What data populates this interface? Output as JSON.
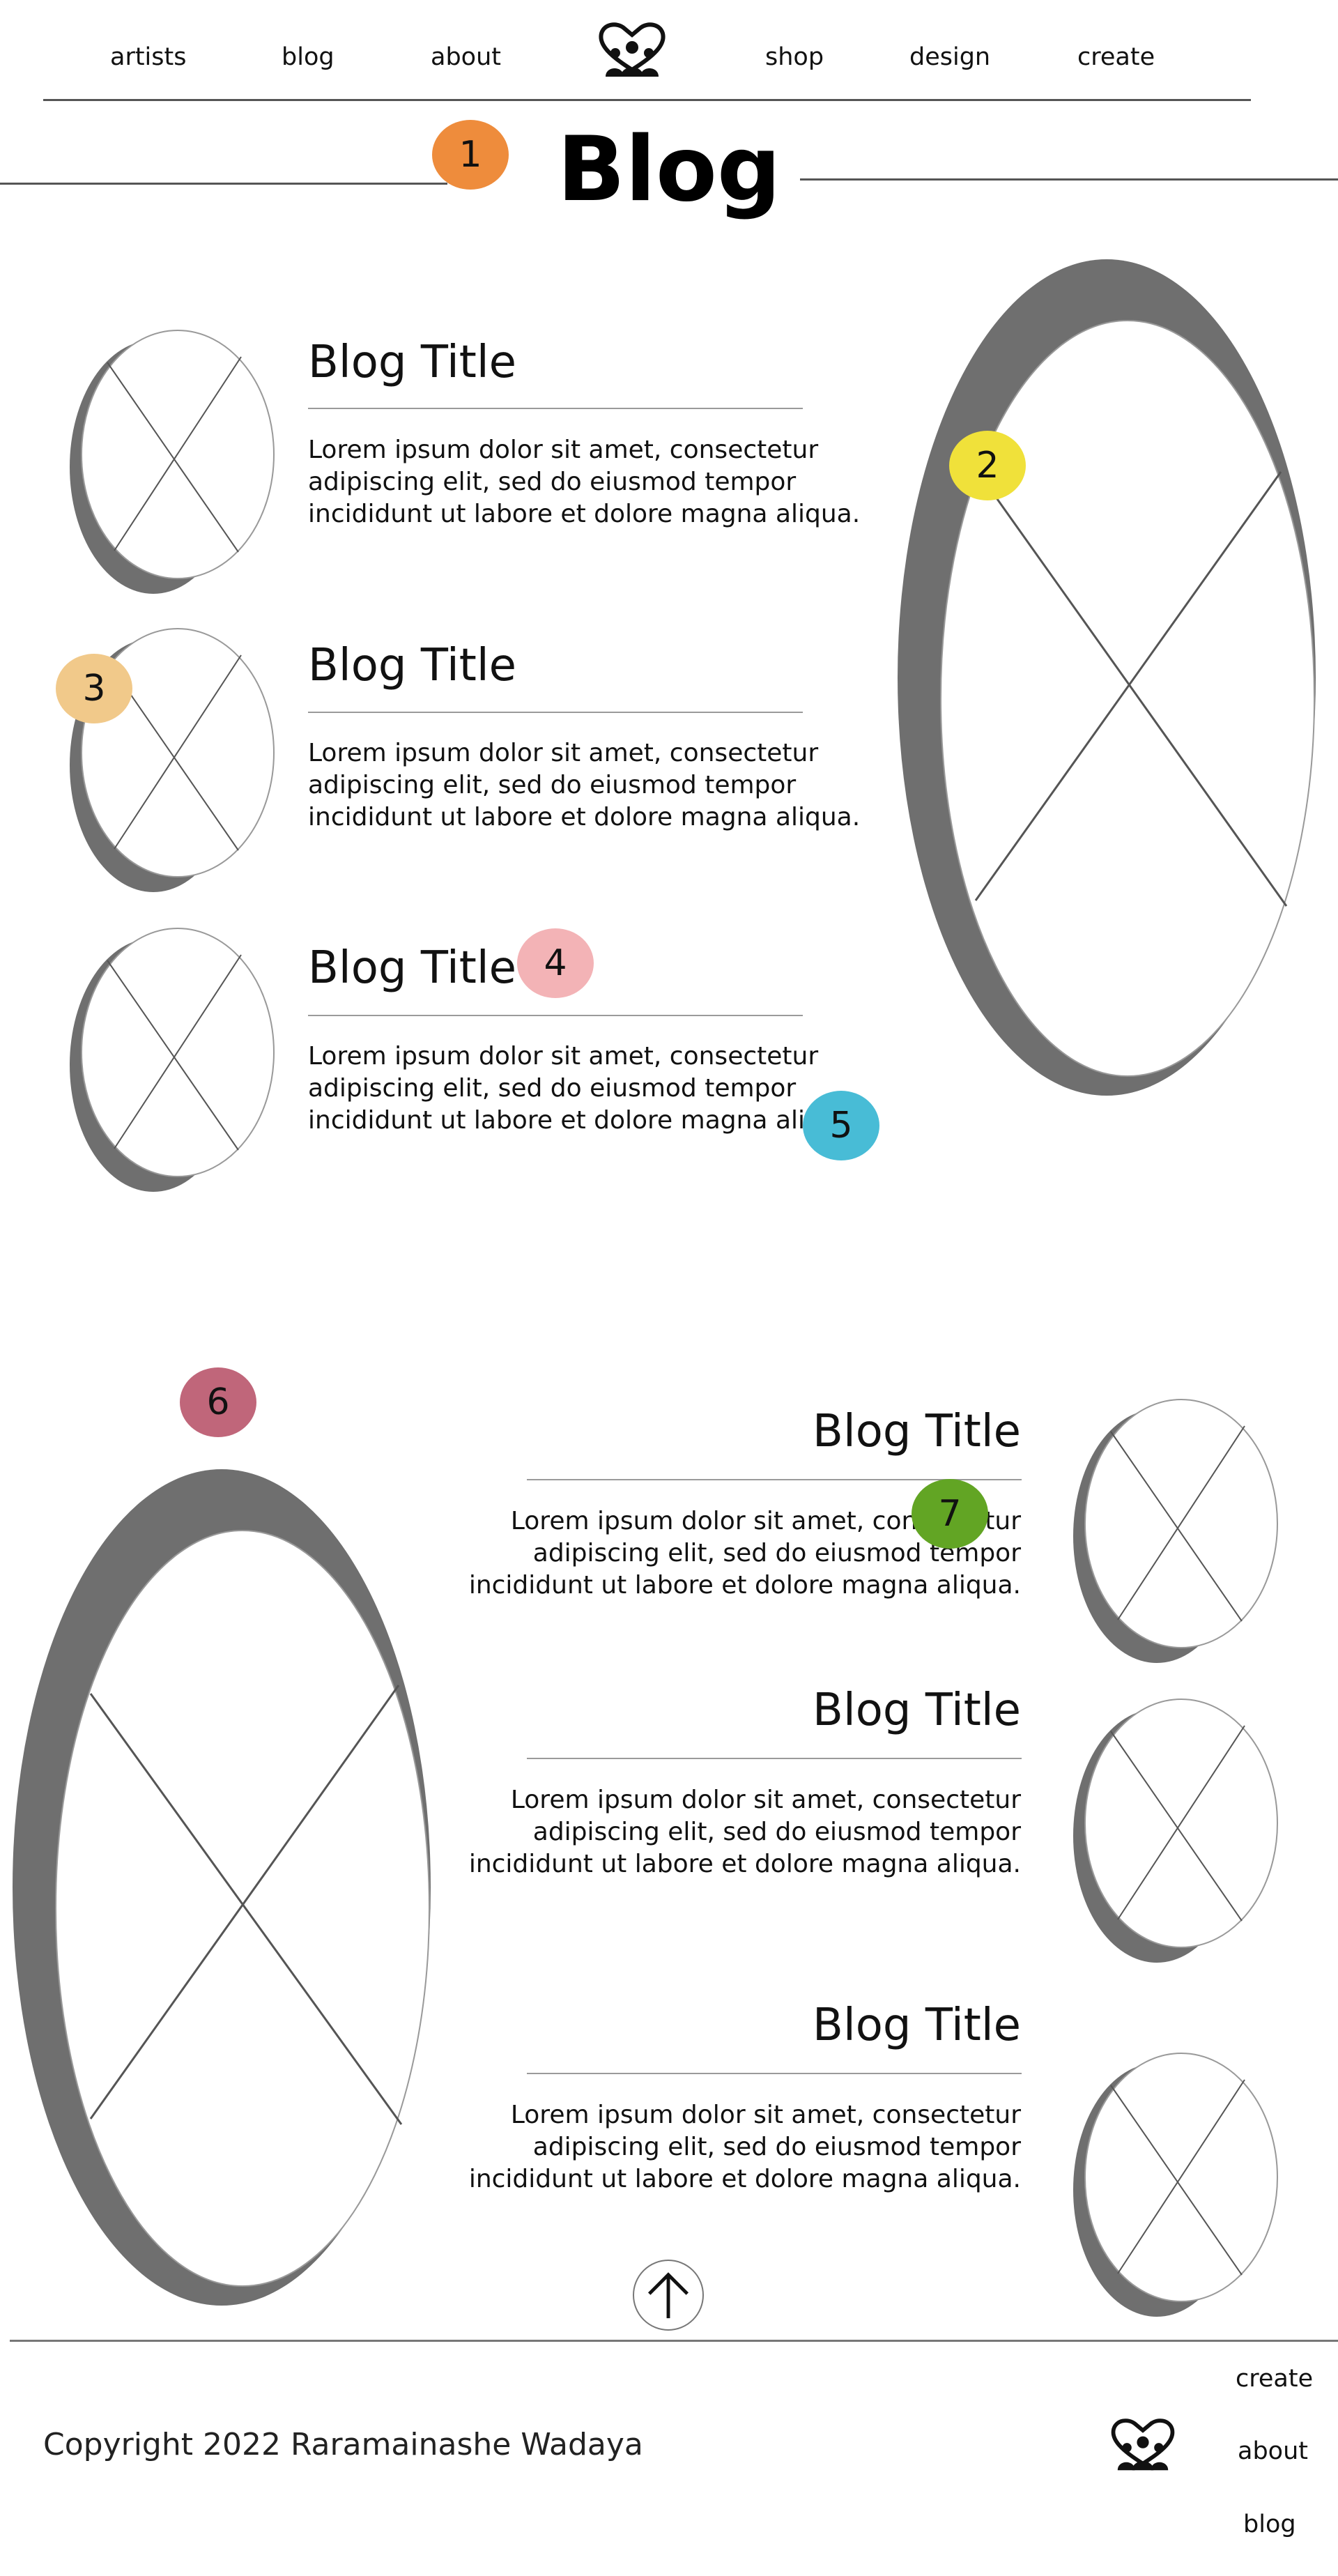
{
  "nav": {
    "items": [
      {
        "label": "artists"
      },
      {
        "label": "blog"
      },
      {
        "label": "about"
      },
      {
        "label": "shop"
      },
      {
        "label": "design"
      },
      {
        "label": "create"
      }
    ],
    "logo_icon": "community-people-icon"
  },
  "page_title": "Blog",
  "posts_section_1": [
    {
      "title": "Blog Title",
      "lines": [
        "Lorem ipsum dolor sit amet, consectetur",
        "adipiscing elit, sed do eiusmod tempor",
        "incididunt ut labore et dolore magna aliqua."
      ]
    },
    {
      "title": "Blog Title",
      "lines": [
        "Lorem ipsum dolor sit amet, consectetur",
        "adipiscing elit, sed do eiusmod tempor",
        "incididunt ut labore et dolore magna aliqua."
      ]
    },
    {
      "title": "Blog Title",
      "lines": [
        "Lorem ipsum dolor sit amet, consectetur",
        "adipiscing elit, sed do eiusmod tempor",
        "incididunt ut labore et dolore magna aliqua."
      ]
    }
  ],
  "posts_section_2": [
    {
      "title": "Blog Title",
      "lines": [
        "Lorem ipsum dolor sit amet, consectetur",
        "adipiscing elit, sed do eiusmod tempor",
        "incididunt ut labore et dolore magna aliqua."
      ]
    },
    {
      "title": "Blog Title",
      "lines": [
        "Lorem ipsum dolor sit amet, consectetur",
        "adipiscing elit, sed do eiusmod tempor",
        "incididunt ut labore et dolore magna aliqua."
      ]
    },
    {
      "title": "Blog Title",
      "lines": [
        "Lorem ipsum dolor sit amet, consectetur",
        "adipiscing elit, sed do eiusmod tempor",
        "incididunt ut labore et dolore magna aliqua."
      ]
    }
  ],
  "badges": [
    {
      "label": "1",
      "color": "#ee8c3c"
    },
    {
      "label": "2",
      "color": "#f0e13a"
    },
    {
      "label": "3",
      "color": "#f1c98a"
    },
    {
      "label": "4",
      "color": "#f3b3b6"
    },
    {
      "label": "5",
      "color": "#48bcd6"
    },
    {
      "label": "6",
      "color": "#c0667a"
    },
    {
      "label": "7",
      "color": "#62a524"
    }
  ],
  "image_placeholder_icon": "image-placeholder-icon",
  "back_to_top_icon": "arrow-up-icon",
  "footer": {
    "copyright": "Copyright 2022 Raramainashe Wadaya",
    "links": [
      {
        "label": "create"
      },
      {
        "label": "about"
      },
      {
        "label": "blog"
      }
    ],
    "logo_icon": "community-people-icon"
  },
  "colors": {
    "shadow": "#6f6f6f",
    "line": "#555555"
  }
}
